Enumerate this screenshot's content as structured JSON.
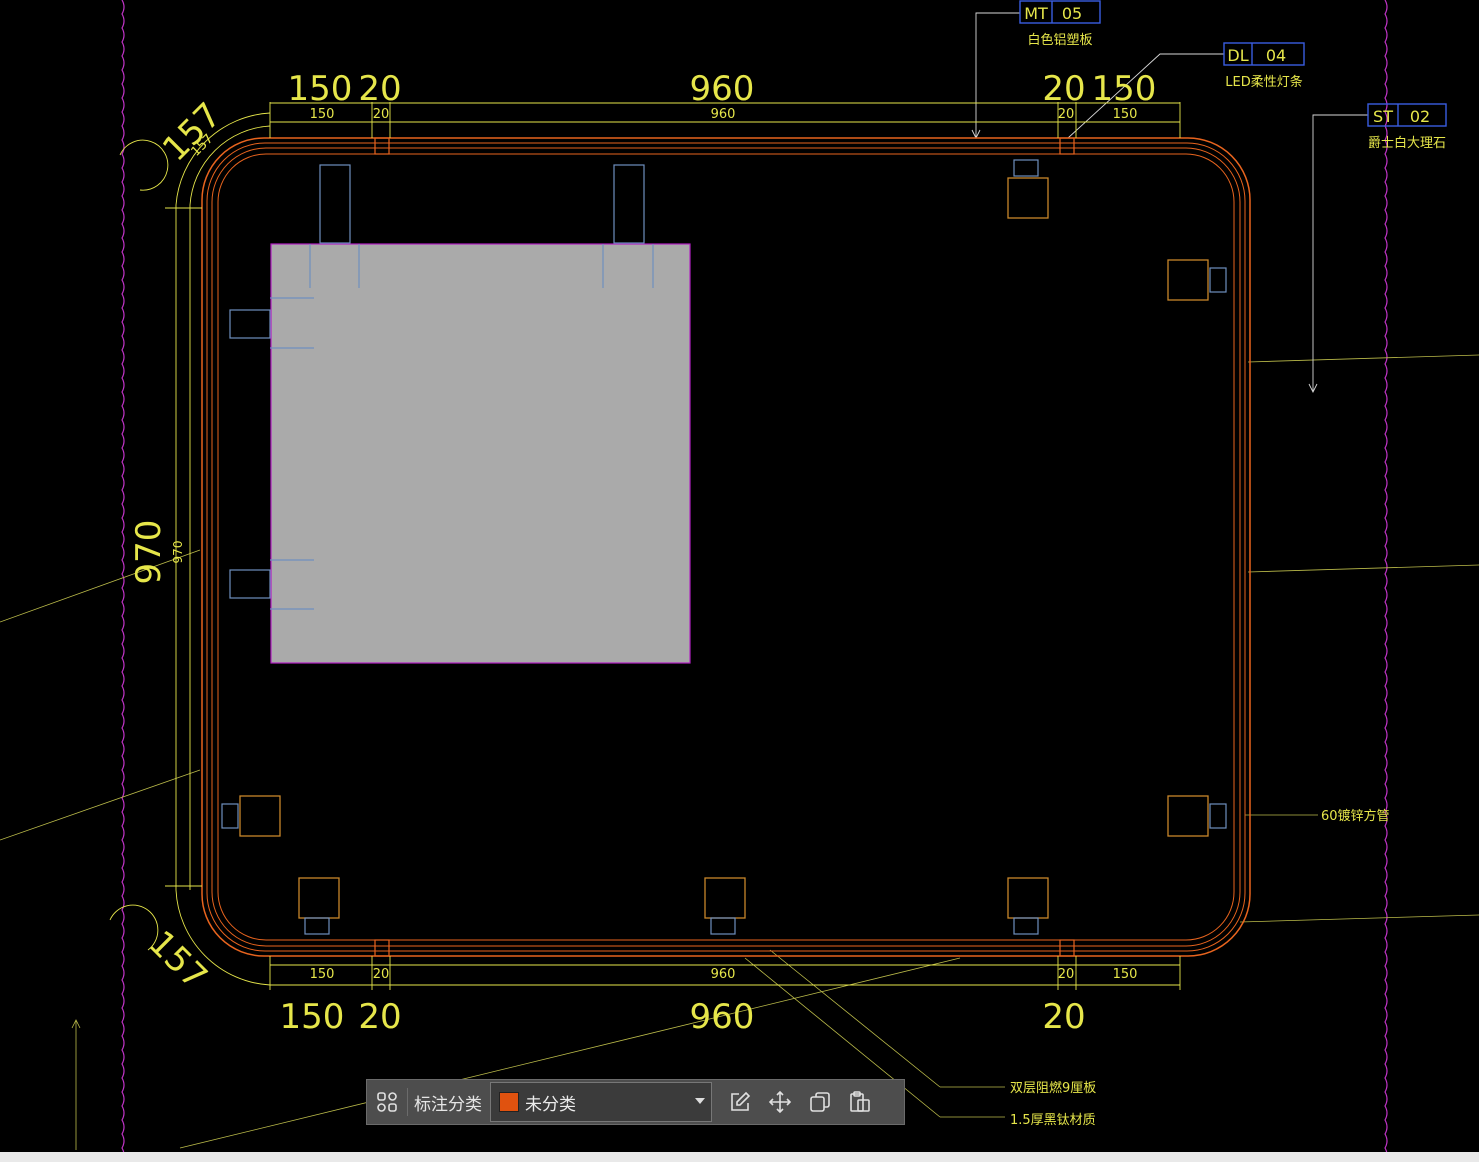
{
  "drawing": {
    "dimensions_large_top": [
      "150",
      "20",
      "960",
      "20",
      "150"
    ],
    "dimensions_small_top": [
      "150",
      "20",
      "960",
      "20",
      "150"
    ],
    "dimensions_large_bottom": [
      "150",
      "20",
      "960",
      "20"
    ],
    "dimensions_small_bottom": [
      "150",
      "20",
      "960",
      "20",
      "150"
    ],
    "radius_large": "157",
    "radius_small": "157",
    "height_large": "970",
    "height_small": "970",
    "tags": [
      {
        "code": "MT",
        "num": "05",
        "desc": "白色铝塑板"
      },
      {
        "code": "DL",
        "num": "04",
        "desc": "LED柔性灯条"
      },
      {
        "code": "ST",
        "num": "02",
        "desc": "爵士白大理石"
      }
    ],
    "notes": {
      "pipe": "60镀锌方管",
      "board": "双层阻燃9厘板",
      "steel": "1.5厚黑钛材质"
    },
    "colors": {
      "frame": "#e8641e",
      "dim": "#e6e64a",
      "boundary": "#c234c8",
      "fixing": "#6f8fbf",
      "highlight": "#aaaaaa"
    }
  },
  "toolbar": {
    "label": "标注分类",
    "category": "未分类",
    "category_color": "#e0520f",
    "icons": [
      "grid-icon",
      "edit-icon",
      "move-icon",
      "copy-icon",
      "paste-icon"
    ]
  }
}
